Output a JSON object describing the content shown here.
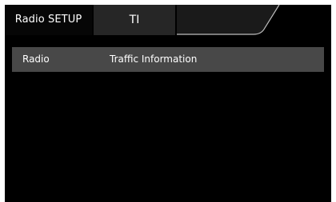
{
  "header": {
    "title": "Radio SETUP",
    "active_tab": "TI"
  },
  "list": {
    "items": [
      {
        "category": "Radio",
        "label": "Traffic Information"
      }
    ]
  },
  "colors": {
    "background": "#000000",
    "row_background": "#484848",
    "tab_background": "#262626",
    "text": "#ffffff"
  }
}
